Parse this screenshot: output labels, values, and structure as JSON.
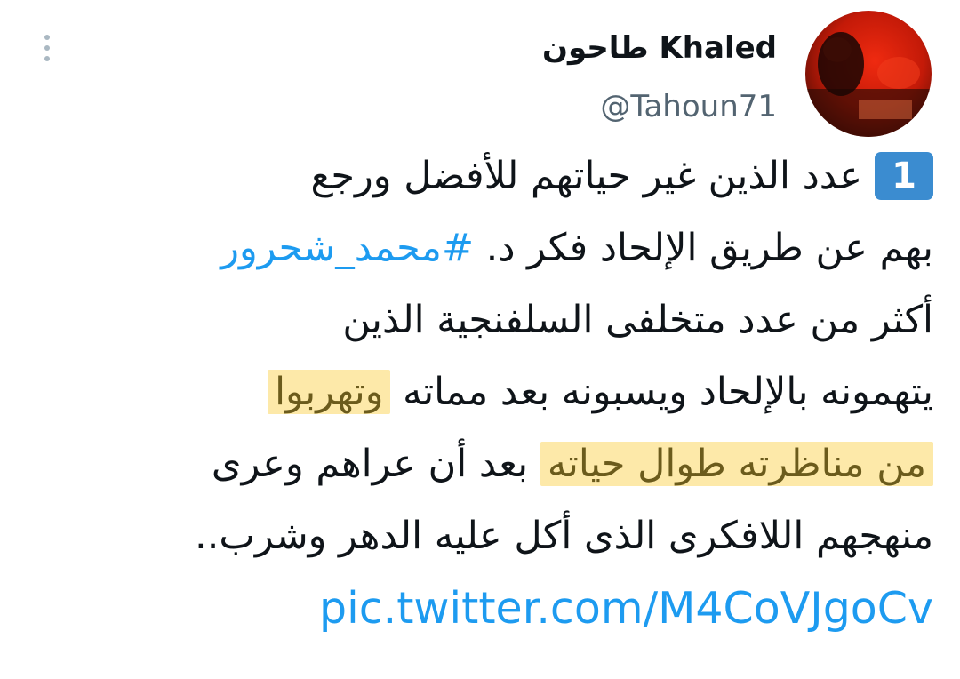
{
  "author": {
    "display_name": "طاحون Khaled",
    "handle": "@Tahoun71"
  },
  "tweet": {
    "badge": "1",
    "lines": [
      "عدد الذين غير حياتهم للأفضل ورجع",
      "بهم عن طريق الإلحاد فكر د. ",
      "أكثر من عدد متخلفى السلفنجية الذين",
      "يتهمونه بالإلحاد ويسبونه بعد مماته ",
      " بعد أن عراهم وعرى",
      "منهجهم اللافكرى الذى أكل عليه الدهر وشرب.."
    ],
    "hashtag": "#محمد_شحرور",
    "highlight_1": "وتهربوا",
    "highlight_2": "من مناظرته طوال حياته",
    "link": "pic.twitter.com/M4CoVJgoCv"
  },
  "colors": {
    "link": "#1d9bf0",
    "badge": "#3b8cd0",
    "highlight": "#fde9a9",
    "secondary_text": "#536471"
  },
  "icons": {
    "more": "more-vertical-icon"
  }
}
